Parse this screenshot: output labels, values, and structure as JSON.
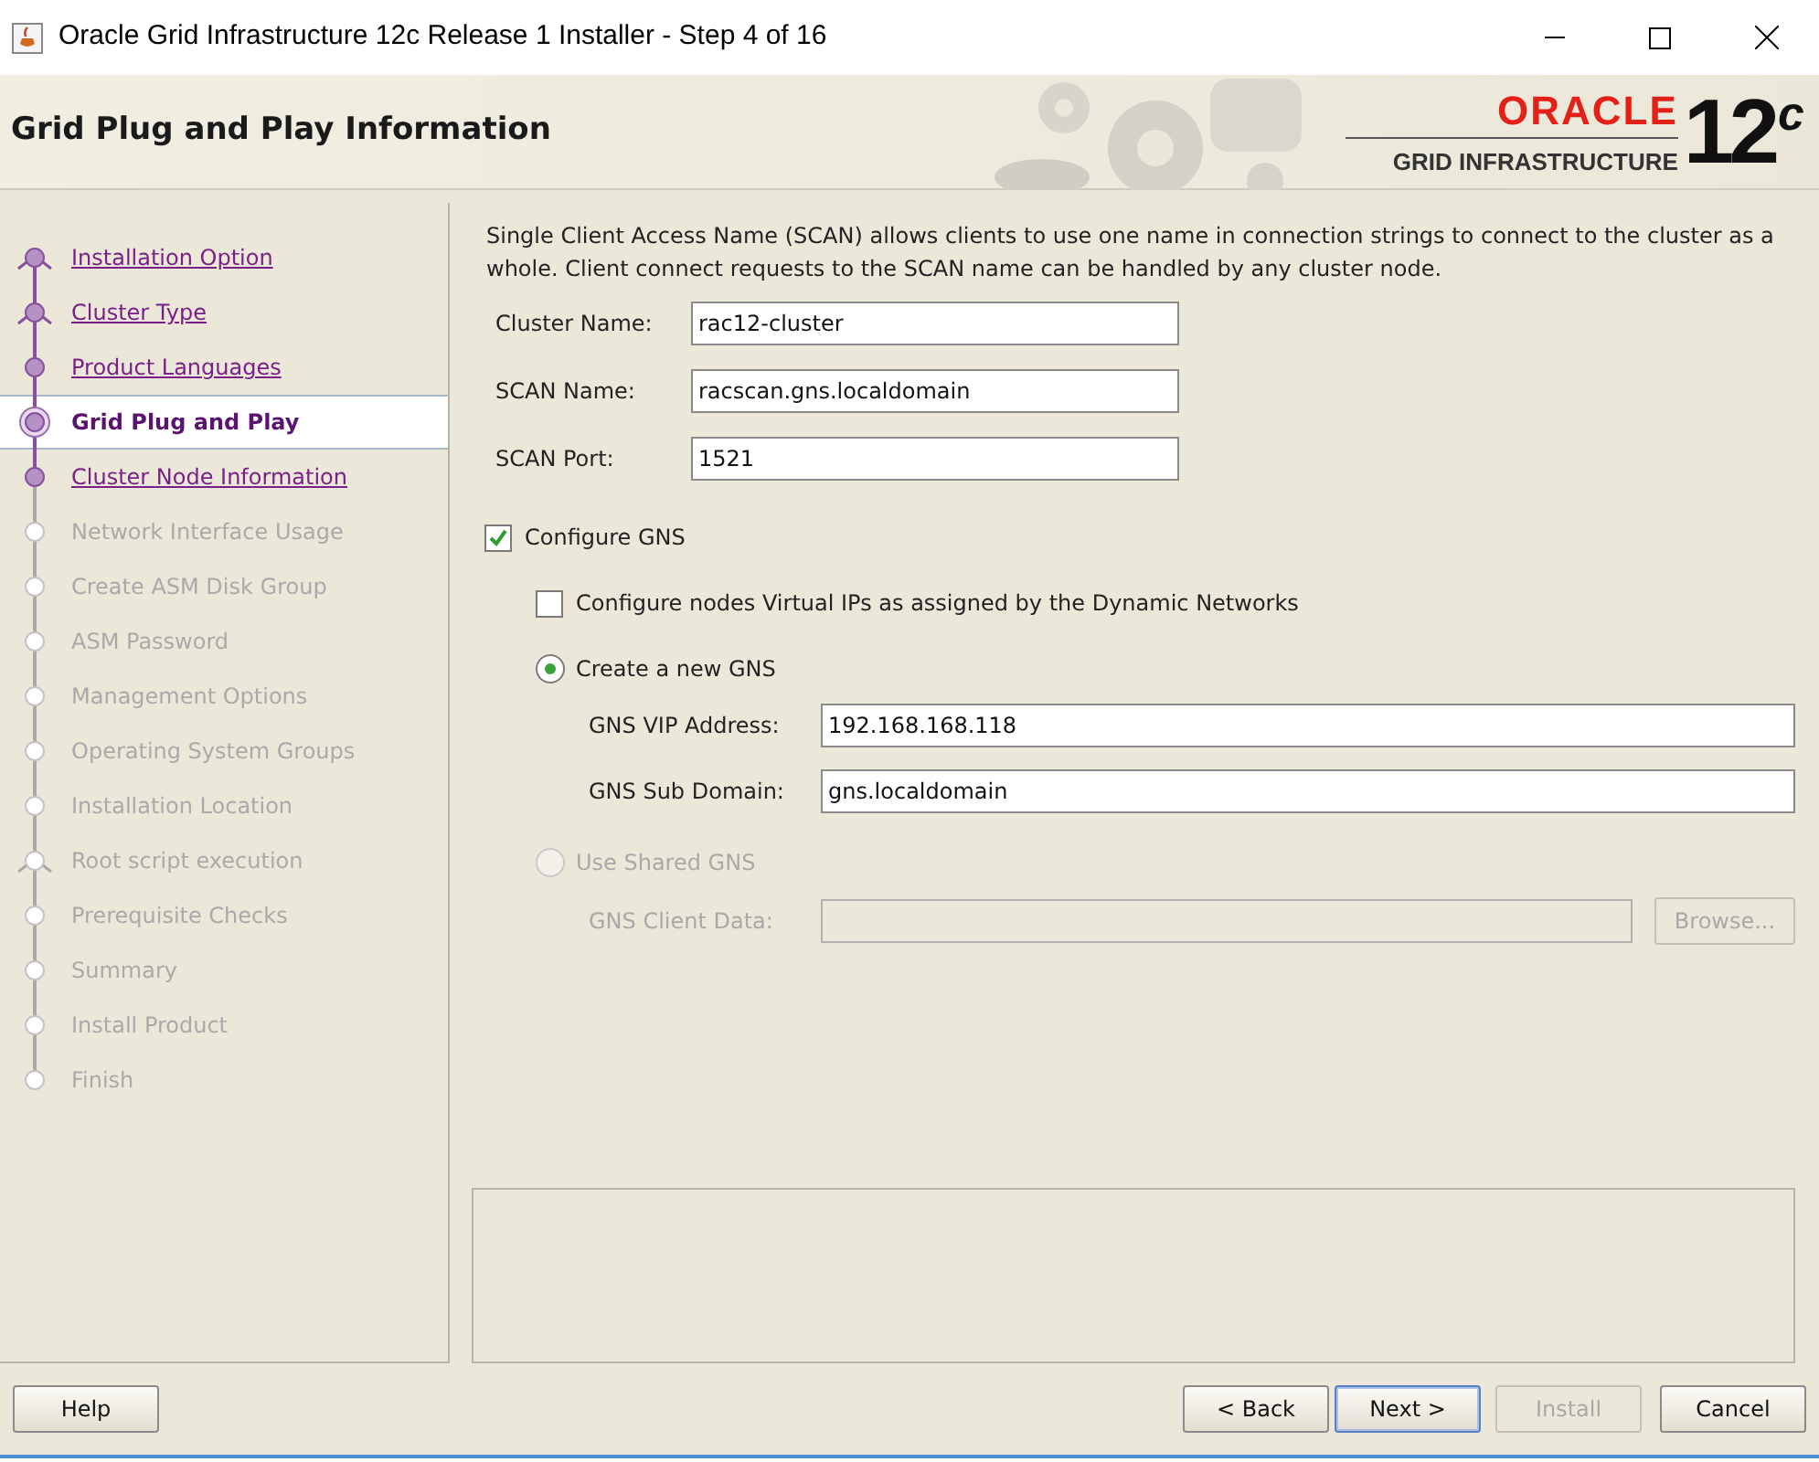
{
  "window": {
    "title": "Oracle Grid Infrastructure 12c Release 1 Installer - Step 4 of 16"
  },
  "header": {
    "title": "Grid Plug and Play Information",
    "logo": {
      "brand": "ORACLE",
      "product": "GRID INFRASTRUCTURE",
      "version": "12",
      "version_suffix": "c"
    }
  },
  "steps": [
    {
      "label": "Installation Option",
      "kind": "done",
      "branch": true
    },
    {
      "label": "Cluster Type",
      "kind": "done",
      "branch": true
    },
    {
      "label": "Product Languages",
      "kind": "done",
      "branch": false
    },
    {
      "label": "Grid Plug and Play",
      "kind": "current",
      "branch": false
    },
    {
      "label": "Cluster Node Information",
      "kind": "done",
      "branch": false
    },
    {
      "label": "Network Interface Usage",
      "kind": "pending",
      "branch": false
    },
    {
      "label": "Create ASM Disk Group",
      "kind": "pending",
      "branch": false
    },
    {
      "label": "ASM Password",
      "kind": "pending",
      "branch": false
    },
    {
      "label": "Management Options",
      "kind": "pending",
      "branch": false
    },
    {
      "label": "Operating System Groups",
      "kind": "pending",
      "branch": false
    },
    {
      "label": "Installation Location",
      "kind": "pending",
      "branch": false
    },
    {
      "label": "Root script execution",
      "kind": "pending",
      "branch": true
    },
    {
      "label": "Prerequisite Checks",
      "kind": "pending",
      "branch": false
    },
    {
      "label": "Summary",
      "kind": "pending",
      "branch": false
    },
    {
      "label": "Install Product",
      "kind": "pending",
      "branch": false
    },
    {
      "label": "Finish",
      "kind": "pending",
      "branch": false
    }
  ],
  "description": "Single Client Access Name (SCAN) allows clients to use one name in connection strings to connect to the cluster as a whole. Client connect requests to the SCAN name can be handled by any cluster node.",
  "fields": [
    {
      "label": "Cluster Name:",
      "value": "rac12-cluster"
    },
    {
      "label": "SCAN Name:",
      "value": "racscan.gns.localdomain"
    },
    {
      "label": "SCAN Port:",
      "value": "1521"
    }
  ],
  "configure_gns": {
    "label": "Configure GNS",
    "checked": true
  },
  "configure_vips": {
    "label": "Configure nodes Virtual IPs as assigned by the Dynamic Networks",
    "checked": false
  },
  "gns_options": [
    {
      "label": "Create a new GNS",
      "selected": true,
      "disabled": false,
      "fields": [
        {
          "label": "GNS VIP Address:",
          "value": "192.168.168.118"
        },
        {
          "label": "GNS Sub Domain:",
          "value": "gns.localdomain"
        }
      ]
    },
    {
      "label": "Use Shared GNS",
      "selected": false,
      "disabled": true,
      "fields": [
        {
          "label": "GNS Client Data:"
        }
      ],
      "button": "Browse..."
    }
  ],
  "buttons": [
    {
      "label": "Help",
      "disabled": false,
      "focused": false
    },
    {
      "label": "< Back",
      "disabled": false,
      "focused": false
    },
    {
      "label": "Next >",
      "disabled": false,
      "focused": true
    },
    {
      "label": "Install",
      "disabled": true,
      "focused": false
    },
    {
      "label": "Cancel",
      "disabled": false,
      "focused": false
    }
  ]
}
